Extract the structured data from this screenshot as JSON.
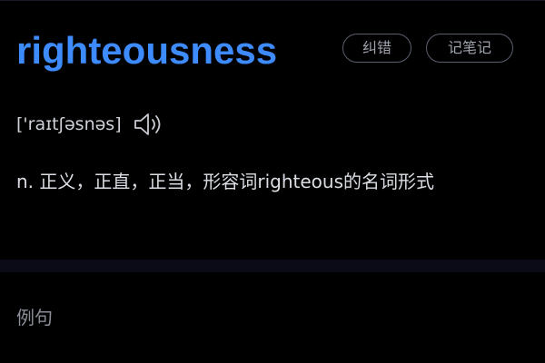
{
  "entry": {
    "word": "righteousness",
    "phonetic": "['raɪtʃəsnəs]",
    "definition": "n. 正义，正直，正当，形容词righteous的名词形式"
  },
  "actions": {
    "correct_label": "纠错",
    "note_label": "记笔记"
  },
  "audio": {
    "icon": "speaker-icon"
  },
  "sections": {
    "examples_label": "例句"
  },
  "colors": {
    "background": "#000000",
    "word": "#3d8bfd",
    "text": "#dadde3",
    "muted": "#8a8e98",
    "pill_border": "#5a5f6e"
  }
}
